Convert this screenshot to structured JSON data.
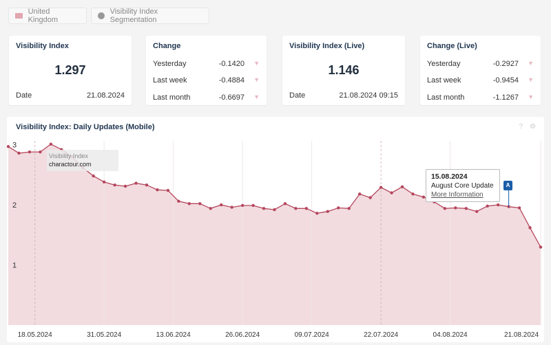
{
  "filters": {
    "country": "United Kingdom",
    "country_icon": "uk-flag-icon",
    "segmentation": "Visibility Index Segmentation",
    "segmentation_icon": "pie-chart-icon"
  },
  "cards": {
    "vi": {
      "title": "Visibility Index",
      "value": "1.297",
      "date_label": "Date",
      "date": "21.08.2024"
    },
    "change": {
      "title": "Change",
      "rows": [
        {
          "label": "Yesterday",
          "value": "-0.1420"
        },
        {
          "label": "Last week",
          "value": "-0.4884"
        },
        {
          "label": "Last month",
          "value": "-0.6697"
        }
      ]
    },
    "vi_live": {
      "title": "Visibility Index (Live)",
      "value": "1.146",
      "date_label": "Date",
      "date": "21.08.2024 09:15"
    },
    "change_live": {
      "title": "Change (Live)",
      "rows": [
        {
          "label": "Yesterday",
          "value": "-0.2927"
        },
        {
          "label": "Last week",
          "value": "-0.9454"
        },
        {
          "label": "Last month",
          "value": "-1.1267"
        }
      ]
    }
  },
  "colors": {
    "line": "#b5475d",
    "fill": "#f2dce0",
    "accent": "#1f3550",
    "marker": "#1a5ea8",
    "down_arrow": "#e8b8c0"
  },
  "chart_data": {
    "type": "area",
    "title": "Visibility Index: Daily Updates (Mobile)",
    "ylim": [
      0,
      3.03
    ],
    "yticks": [
      1,
      2,
      3
    ],
    "xticks": [
      "18.05.2024",
      "31.05.2024",
      "13.06.2024",
      "26.06.2024",
      "09.07.2024",
      "22.07.2024",
      "04.08.2024",
      "21.08.2024"
    ],
    "xticks_iso": [
      "2024-05-18",
      "2024-05-31",
      "2024-06-13",
      "2024-06-26",
      "2024-07-09",
      "2024-07-22",
      "2024-08-04",
      "2024-08-21"
    ],
    "grid": true,
    "series": [
      {
        "legend_title": "Visibility Index",
        "name": "charactour.com",
        "x": [
          "2024-05-13",
          "2024-05-15",
          "2024-05-17",
          "2024-05-19",
          "2024-05-21",
          "2024-05-23",
          "2024-05-25",
          "2024-05-27",
          "2024-05-29",
          "2024-05-31",
          "2024-06-02",
          "2024-06-04",
          "2024-06-06",
          "2024-06-08",
          "2024-06-10",
          "2024-06-12",
          "2024-06-14",
          "2024-06-16",
          "2024-06-18",
          "2024-06-20",
          "2024-06-22",
          "2024-06-24",
          "2024-06-26",
          "2024-06-28",
          "2024-06-30",
          "2024-07-02",
          "2024-07-04",
          "2024-07-06",
          "2024-07-08",
          "2024-07-10",
          "2024-07-12",
          "2024-07-14",
          "2024-07-16",
          "2024-07-18",
          "2024-07-20",
          "2024-07-22",
          "2024-07-24",
          "2024-07-26",
          "2024-07-28",
          "2024-07-30",
          "2024-08-01",
          "2024-08-03",
          "2024-08-05",
          "2024-08-07",
          "2024-08-09",
          "2024-08-11",
          "2024-08-13",
          "2024-08-15",
          "2024-08-17",
          "2024-08-19",
          "2024-08-21"
        ],
        "values": [
          2.97,
          2.86,
          2.88,
          2.88,
          3.01,
          2.92,
          2.8,
          2.62,
          2.48,
          2.38,
          2.33,
          2.31,
          2.36,
          2.33,
          2.25,
          2.24,
          2.06,
          2.02,
          2.02,
          1.94,
          2.0,
          1.96,
          1.99,
          1.99,
          1.94,
          1.92,
          2.02,
          1.94,
          1.94,
          1.86,
          1.89,
          1.95,
          1.94,
          2.18,
          2.12,
          2.29,
          2.2,
          2.3,
          2.18,
          2.13,
          2.05,
          1.94,
          1.95,
          1.94,
          1.89,
          1.98,
          2.0,
          1.97,
          1.95,
          1.62,
          1.297
        ]
      }
    ],
    "annotation": {
      "date": "15.08.2024",
      "date_iso": "2024-08-15",
      "label": "August Core Update",
      "link": "More Information",
      "marker": "A"
    },
    "help": "?",
    "settings_icon": "gear-icon"
  }
}
